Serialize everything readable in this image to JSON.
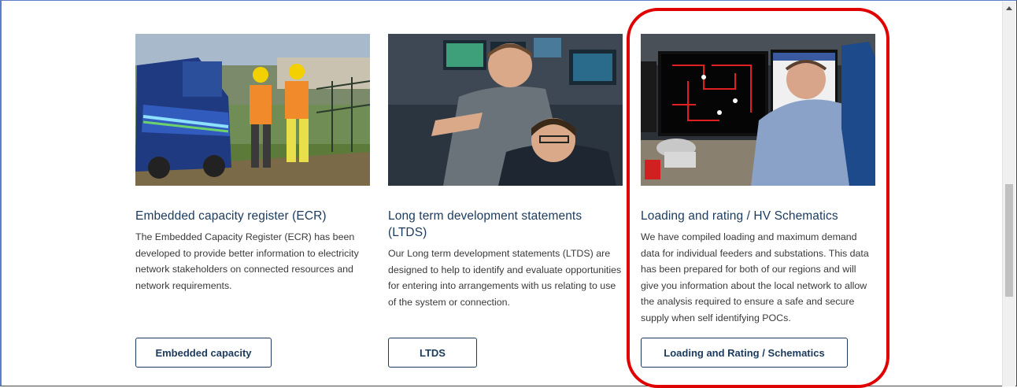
{
  "cards": [
    {
      "title": "Embedded capacity register (ECR)",
      "description": "The Embedded Capacity Register (ECR) has been developed to provide better information to electricity network stakeholders on connected resources and network requirements.",
      "button_label": "Embedded capacity"
    },
    {
      "title": "Long term development statements (LTDS)",
      "description": "Our Long term development statements (LTDS) are designed to help to identify and evaluate opportunities for entering into arrangements with us relating to use of the system or connection.",
      "button_label": "LTDS"
    },
    {
      "title": "Loading and rating / HV Schematics",
      "description": "We have compiled loading and maximum demand data for individual feeders and substations. This data has been prepared for both of our regions and will give you information about the local network to allow the analysis required to ensure a safe and secure supply when self identifying POCs.",
      "button_label": "Loading and Rating / Schematics"
    }
  ],
  "colors": {
    "title": "#1b3a5c",
    "highlight": "#e10000"
  }
}
